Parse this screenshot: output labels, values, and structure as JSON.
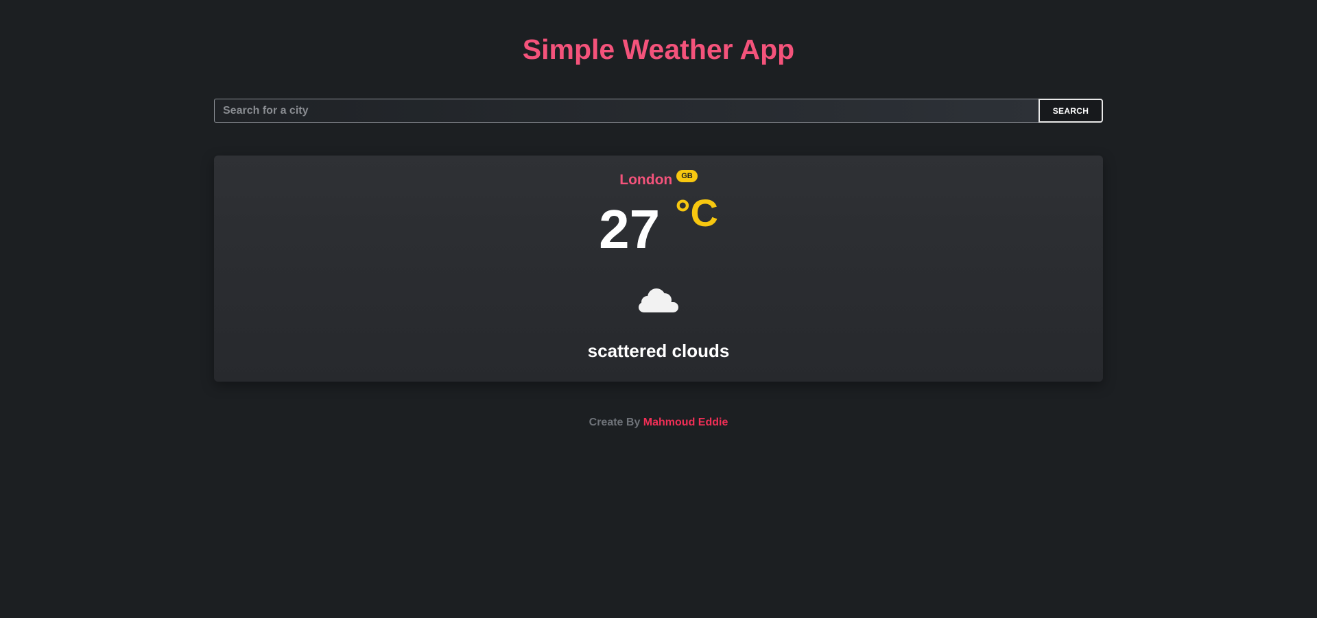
{
  "app": {
    "title": "Simple Weather App"
  },
  "search": {
    "placeholder": "Search for a city",
    "value": "",
    "button_label": "SEARCH"
  },
  "weather": {
    "city": "London",
    "country": "GB",
    "temperature": "27",
    "unit": "°C",
    "icon": "cloud-icon",
    "description": "scattered clouds"
  },
  "footer": {
    "prefix": "Create By",
    "author": "Mahmoud Eddie"
  },
  "colors": {
    "background": "#1c1f22",
    "accent_pink": "#f4537b",
    "accent_yellow": "#f7c710",
    "author_link": "#f02f56"
  }
}
